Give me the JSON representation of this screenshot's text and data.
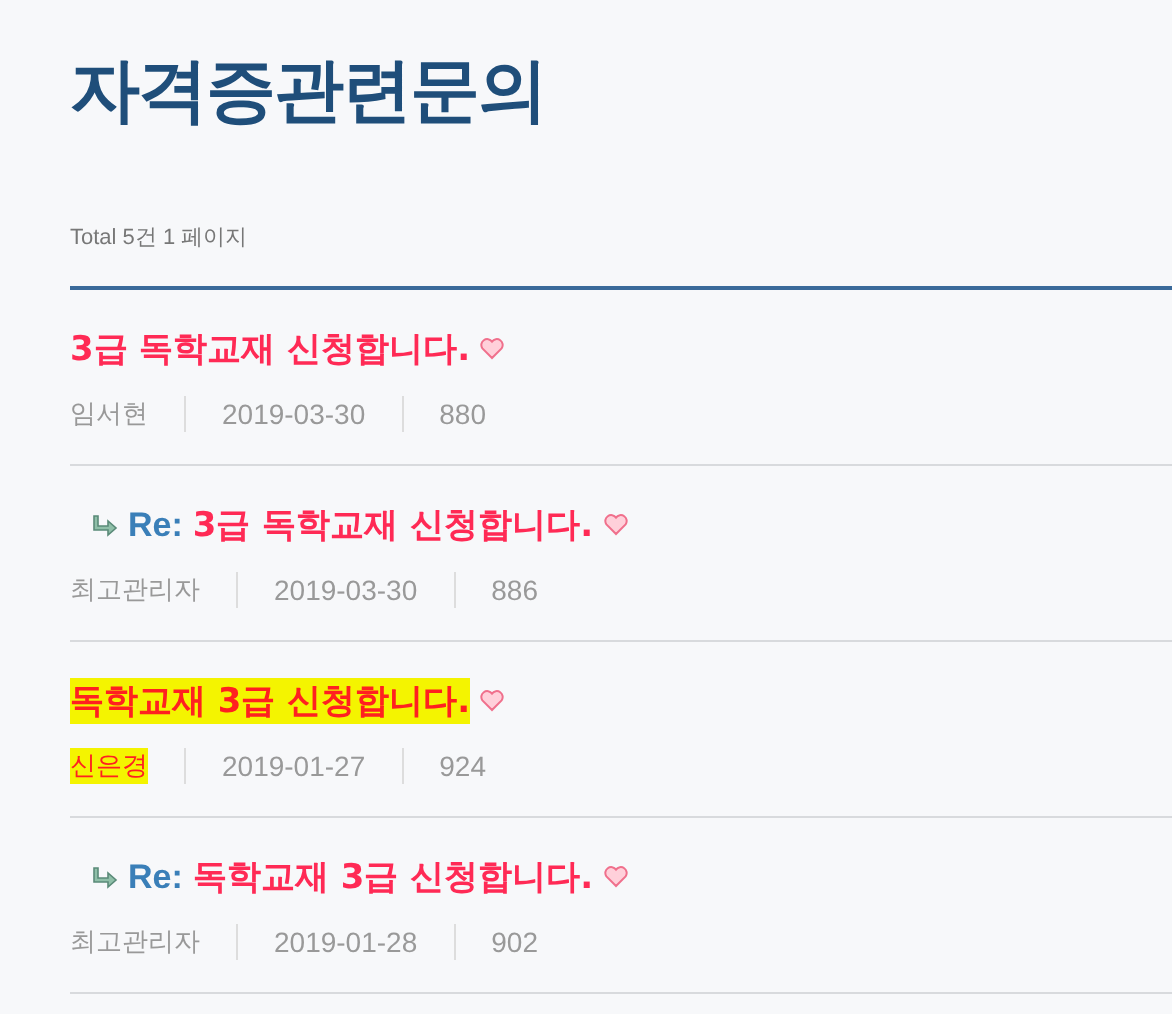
{
  "page_title": "자격증관련문의",
  "summary": "Total 5건 1 페이지",
  "posts": [
    {
      "kind": "post",
      "title": "3급 독학교재 신청합니다.",
      "author": "임서현",
      "date": "2019-03-30",
      "views": "880",
      "highlighted": false
    },
    {
      "kind": "reply",
      "prefix": "Re:",
      "title": "3급 독학교재 신청합니다.",
      "author": "최고관리자",
      "date": "2019-03-30",
      "views": "886",
      "highlighted": false
    },
    {
      "kind": "post",
      "title": "독학교재 3급 신청합니다.",
      "author": "신은경",
      "date": "2019-01-27",
      "views": "924",
      "highlighted": true
    },
    {
      "kind": "reply",
      "prefix": "Re:",
      "title": "독학교재 3급 신청합니다.",
      "author": "최고관리자",
      "date": "2019-01-28",
      "views": "902",
      "highlighted": false
    }
  ]
}
